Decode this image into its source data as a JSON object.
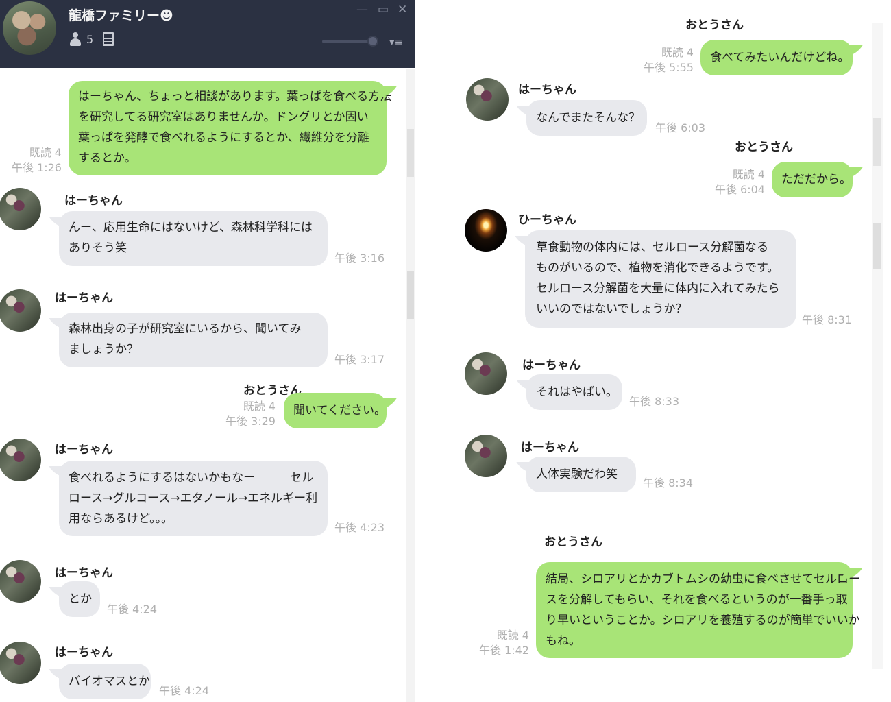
{
  "header": {
    "group_name": "龍橋ファミリー☻",
    "member_count": "5",
    "controls": {
      "minimize": "—",
      "maximize": "▭",
      "close": "✕",
      "menu": "▾≡"
    }
  },
  "left_messages": [
    {
      "dir": "out",
      "text": "はーちゃん、ちょっと相談があります。葉っぱを食べる方法\nを研究してる研究室はありませんか。ドングリとか固い\n葉っぱを発酵で食べれるようにするとか、繊維分を分離\nするとか。",
      "read": "既読 4",
      "time": "午後 1:26"
    },
    {
      "sender": "はーちゃん",
      "dir": "in",
      "text": "んー、応用生命にはないけど、森林科学科には\nありそう笑",
      "time": "午後 3:16"
    },
    {
      "sender": "はーちゃん",
      "dir": "in",
      "text": "森林出身の子が研究室にいるから、聞いてみ\nましょうか？",
      "time": "午後 3:17"
    },
    {
      "sender": "おとうさん",
      "dir": "out",
      "text": "聞いてください。",
      "read": "既読 4",
      "time": "午後 3:29"
    },
    {
      "sender": "はーちゃん",
      "dir": "in",
      "text": "食べれるようにするはないかもなー　　　セル\nロース→グルコース→エタノール→エネルギー利\n用ならあるけど。。。",
      "time": "午後 4:23"
    },
    {
      "sender": "はーちゃん",
      "dir": "in",
      "text": "とか",
      "time": "午後 4:24"
    },
    {
      "sender": "はーちゃん",
      "dir": "in",
      "text": "バイオマスとか",
      "time": "午後 4:24"
    }
  ],
  "right_messages": [
    {
      "sender": "おとうさん",
      "dir": "out",
      "text": "食べてみたいんだけどね。",
      "read": "既読 4",
      "time": "午後 5:55"
    },
    {
      "sender": "はーちゃん",
      "dir": "in",
      "text": "なんでまたそんな？",
      "time": "午後 6:03"
    },
    {
      "sender": "おとうさん",
      "dir": "out",
      "text": "ただだから。",
      "read": "既読 4",
      "time": "午後 6:04"
    },
    {
      "sender": "ひーちゃん",
      "dir": "in",
      "text": "草食動物の体内には、セルロース分解菌なる\nものがいるので、植物を消化できるようです。\nセルロース分解菌を大量に体内に入れてみたら\nいいのではないでしょうか？",
      "time": "午後 8:31"
    },
    {
      "sender": "はーちゃん",
      "dir": "in",
      "text": "それはやばい。",
      "time": "午後 8:33"
    },
    {
      "sender": "はーちゃん",
      "dir": "in",
      "text": "人体実験だわ笑",
      "time": "午後 8:34"
    },
    {
      "sender": "おとうさん",
      "dir": "out",
      "text": "結局、シロアリとかカブトムシの幼虫に食べさせてセルロー\nスを分解してもらい、それを食べるというのが一番手っ取\nり早いということか。シロアリを養殖するのが簡単でいいか\nもね。",
      "read": "既読 4",
      "time": "午後 1:42"
    }
  ],
  "colors": {
    "titlebar": "#2b3142",
    "outgoing_bubble": "#a8e477",
    "incoming_bubble": "#e8e9ed",
    "meta_text": "#b0b0b0"
  }
}
